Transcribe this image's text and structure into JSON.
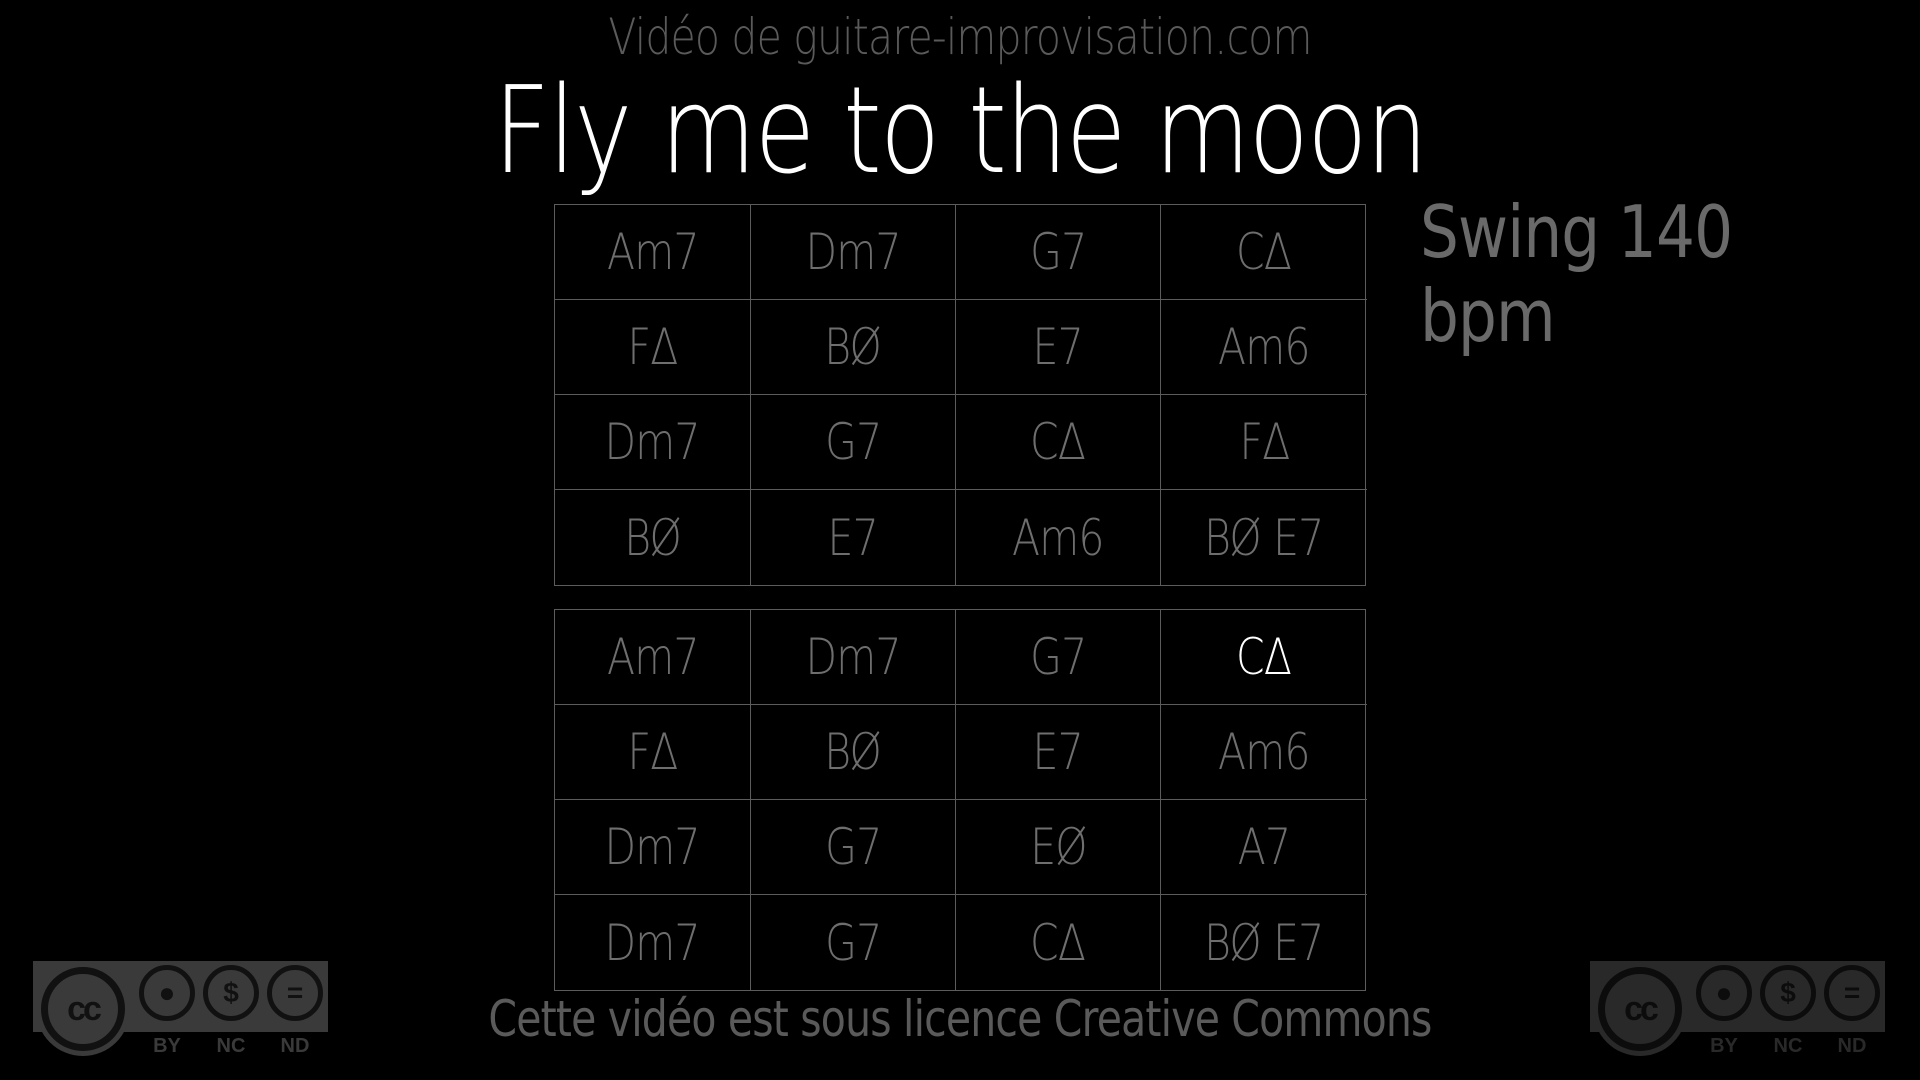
{
  "header": {
    "site_credit": "Vidéo de guitare-improvisation.com",
    "song_title": "Fly me to the moon",
    "tempo": "Swing 140 bpm"
  },
  "chord_grids": [
    {
      "rows": [
        [
          "Am7",
          "Dm7",
          "G7",
          "C∆"
        ],
        [
          "F∆",
          "BØ",
          "E7",
          "Am6"
        ],
        [
          "Dm7",
          "G7",
          "C∆",
          "F∆"
        ],
        [
          "BØ",
          "E7",
          "Am6",
          "BØ  E7"
        ]
      ]
    },
    {
      "rows": [
        [
          "Am7",
          "Dm7",
          "G7",
          "C∆"
        ],
        [
          "F∆",
          "BØ",
          "E7",
          "Am6"
        ],
        [
          "Dm7",
          "G7",
          "EØ",
          "A7"
        ],
        [
          "Dm7",
          "G7",
          "C∆",
          "BØ  E7"
        ]
      ]
    }
  ],
  "current_chord": {
    "grid": 1,
    "row": 0,
    "col": 3
  },
  "footer": {
    "license_text": "Cette vidéo est sous licence Creative Commons"
  },
  "license_badge": {
    "main": "cc",
    "icons": [
      "by-person-icon",
      "nc-dollar-icon",
      "nd-equals-icon"
    ],
    "labels": [
      "BY",
      "NC",
      "ND"
    ]
  },
  "colors": {
    "background": "#000000",
    "title": "#ffffff",
    "chord_text": "#6e6e6e",
    "active_chord": "#ffffff",
    "grid_lines": "#5c5c5c"
  }
}
